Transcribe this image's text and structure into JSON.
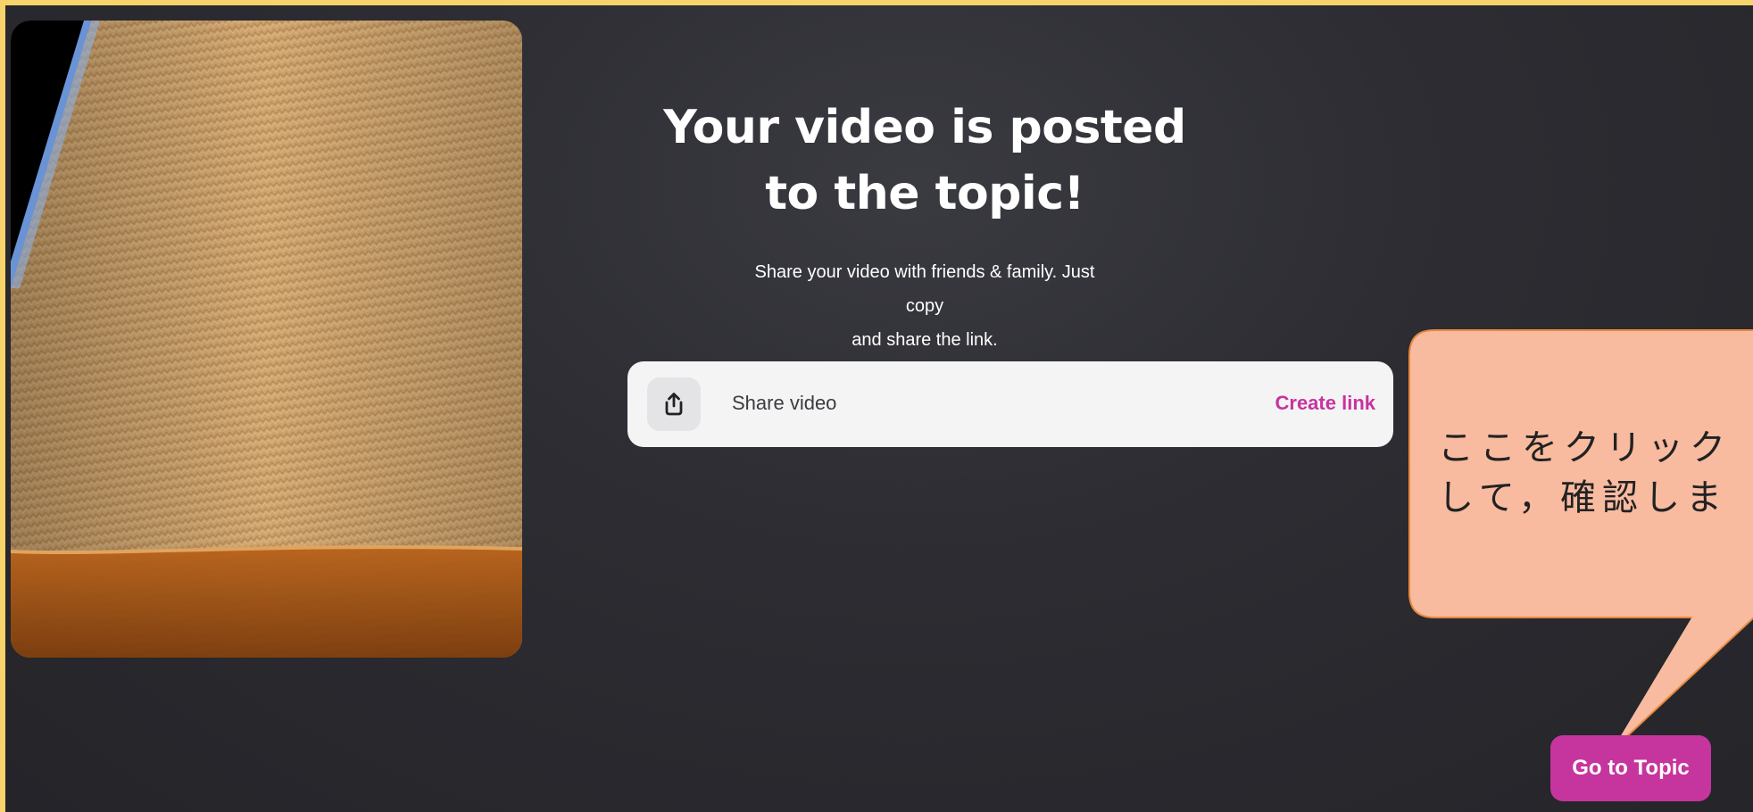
{
  "headline": {
    "line1": "Your video is posted",
    "line2": "to the topic!"
  },
  "subtext": {
    "line1": "Share your video with friends & family. Just copy",
    "line2": "and share the link."
  },
  "share_card": {
    "icon": "share-upload-icon",
    "label": "Share video",
    "action_label": "Create link"
  },
  "callout": {
    "line1": "ここをクリック",
    "line2": "して，確認しま"
  },
  "go_to_topic": {
    "label": "Go to Topic"
  },
  "colors": {
    "accent": "#c6359d",
    "link": "#c8339f",
    "frame": "#F6D46B",
    "callout_fill": "#F8BBA0",
    "callout_border": "#E8893F",
    "background": "#2d2d33"
  }
}
